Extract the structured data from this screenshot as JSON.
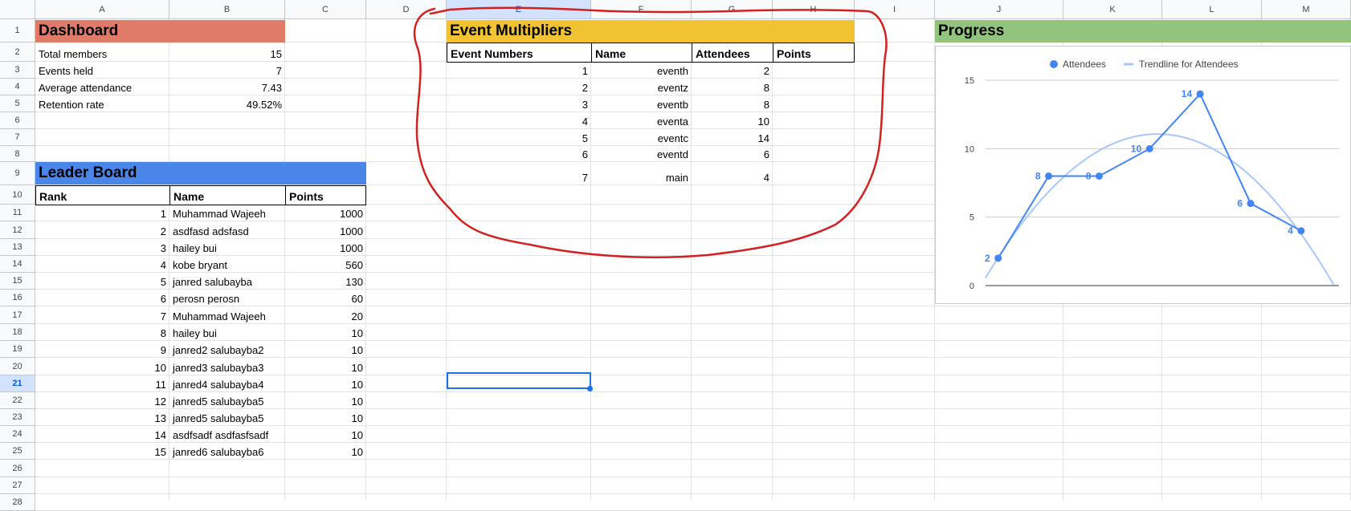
{
  "columns": [
    "A",
    "B",
    "C",
    "D",
    "E",
    "F",
    "G",
    "H",
    "I",
    "J",
    "K",
    "L",
    "M"
  ],
  "rows": [
    "1",
    "2",
    "3",
    "4",
    "5",
    "6",
    "7",
    "8",
    "9",
    "10",
    "11",
    "12",
    "13",
    "14",
    "15",
    "16",
    "17",
    "18",
    "19",
    "20",
    "21",
    "22",
    "23",
    "24",
    "25",
    "26",
    "27",
    "28"
  ],
  "selected_column": "E",
  "selected_row": "21",
  "dashboard": {
    "title": "Dashboard",
    "color": "#e07b6a",
    "stats": [
      {
        "label": "Total members",
        "value": "15"
      },
      {
        "label": "Events held",
        "value": "7"
      },
      {
        "label": "Average attendance",
        "value": "7.43"
      },
      {
        "label": "Retention rate",
        "value": "49.52%"
      }
    ]
  },
  "leaderboard": {
    "title": "Leader Board",
    "color": "#4a86e8",
    "headers": [
      "Rank",
      "Name",
      "Points"
    ],
    "rows": [
      {
        "rank": "1",
        "name": "Muhammad Wajeeh",
        "points": "1000"
      },
      {
        "rank": "2",
        "name": "asdfasd adsfasd",
        "points": "1000"
      },
      {
        "rank": "3",
        "name": "hailey bui",
        "points": "1000"
      },
      {
        "rank": "4",
        "name": "kobe bryant",
        "points": "560"
      },
      {
        "rank": "5",
        "name": "janred salubayba",
        "points": "130"
      },
      {
        "rank": "6",
        "name": "perosn perosn",
        "points": "60"
      },
      {
        "rank": "7",
        "name": "Muhammad Wajeeh",
        "points": "20"
      },
      {
        "rank": "8",
        "name": "hailey bui",
        "points": "10"
      },
      {
        "rank": "9",
        "name": "janred2 salubayba2",
        "points": "10"
      },
      {
        "rank": "10",
        "name": "janred3 salubayba3",
        "points": "10"
      },
      {
        "rank": "11",
        "name": "janred4 salubayba4",
        "points": "10"
      },
      {
        "rank": "12",
        "name": "janred5 salubayba5",
        "points": "10"
      },
      {
        "rank": "13",
        "name": "janred5 salubayba5",
        "points": "10"
      },
      {
        "rank": "14",
        "name": "asdfsadf asdfasfsadf",
        "points": "10"
      },
      {
        "rank": "15",
        "name": "janred6 salubayba6",
        "points": "10"
      }
    ]
  },
  "events": {
    "title": "Event Multipliers",
    "color": "#f1c232",
    "headers": [
      "Event Numbers",
      "Name",
      "Attendees",
      "Points"
    ],
    "rows": [
      {
        "num": "1",
        "name": "eventh",
        "attendees": "2",
        "points": ""
      },
      {
        "num": "2",
        "name": "eventz",
        "attendees": "8",
        "points": ""
      },
      {
        "num": "3",
        "name": "eventb",
        "attendees": "8",
        "points": ""
      },
      {
        "num": "4",
        "name": "eventa",
        "attendees": "10",
        "points": ""
      },
      {
        "num": "5",
        "name": "eventc",
        "attendees": "14",
        "points": ""
      },
      {
        "num": "6",
        "name": "eventd",
        "attendees": "6",
        "points": ""
      },
      {
        "num": "7",
        "name": "main",
        "attendees": "4",
        "points": ""
      }
    ]
  },
  "progress": {
    "title": "Progress",
    "color": "#93c47d"
  },
  "annotation_color": "#d32020",
  "chart_data": {
    "type": "line",
    "x": [
      1,
      2,
      3,
      4,
      5,
      6,
      7
    ],
    "series": [
      {
        "name": "Attendees",
        "values": [
          2,
          8,
          8,
          10,
          14,
          6,
          4
        ],
        "color": "#4285f4"
      },
      {
        "name": "Trendline for Attendees",
        "color": "#a8c7fa",
        "trend": "polynomial"
      }
    ],
    "point_labels": [
      "2",
      "8",
      "8",
      "10",
      "14",
      "6",
      "4"
    ],
    "yticks": [
      "0",
      "5",
      "10",
      "15"
    ],
    "ylim": [
      0,
      15
    ],
    "legend": "top",
    "grid": true
  }
}
